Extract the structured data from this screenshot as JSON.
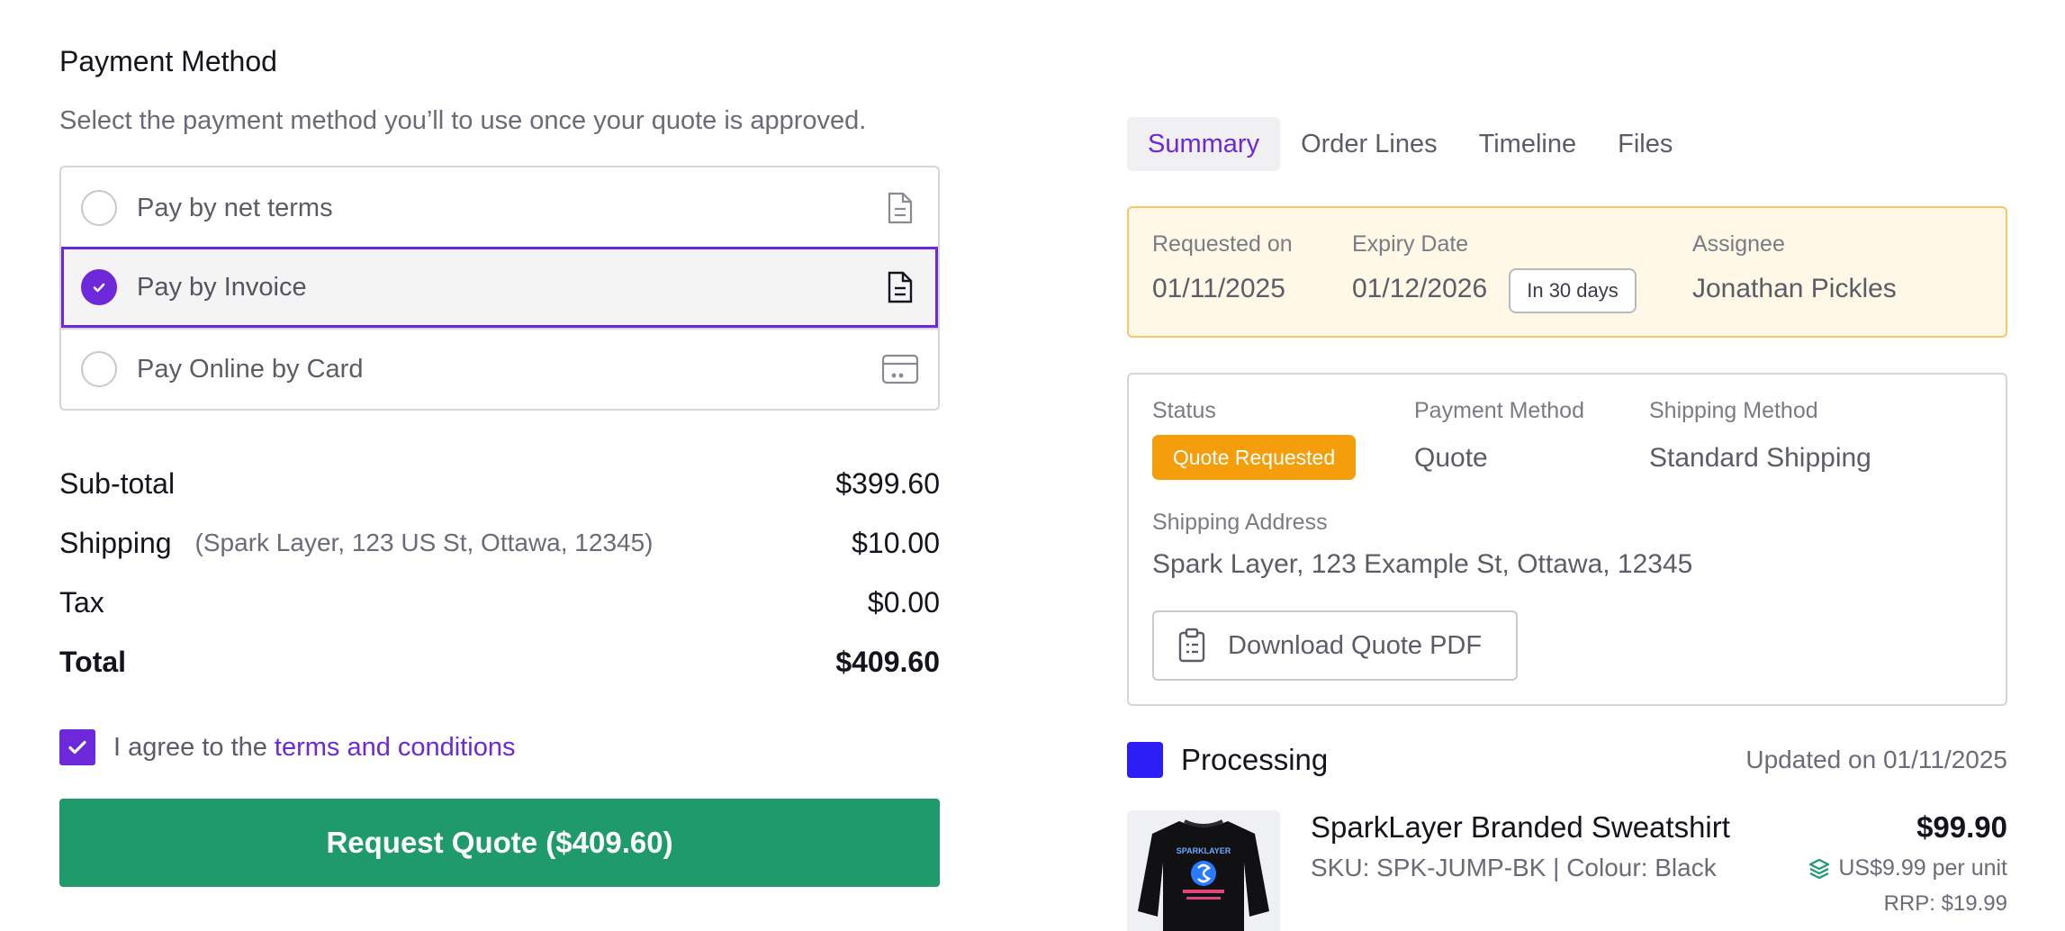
{
  "payment": {
    "title": "Payment Method",
    "subtitle": "Select the payment method you’ll to use once your quote is approved.",
    "options": [
      {
        "label": "Pay by net terms",
        "selected": false,
        "icon": "document-lines-icon"
      },
      {
        "label": "Pay by Invoice",
        "selected": true,
        "icon": "invoice-icon"
      },
      {
        "label": "Pay Online by Card",
        "selected": false,
        "icon": "credit-card-icon"
      }
    ]
  },
  "totals": {
    "subtotal_label": "Sub-total",
    "subtotal_value": "$399.60",
    "shipping_label": "Shipping",
    "shipping_note": "(Spark Layer, 123 US St, Ottawa, 12345)",
    "shipping_value": "$10.00",
    "tax_label": "Tax",
    "tax_value": "$0.00",
    "total_label": "Total",
    "total_value": "$409.60"
  },
  "agreement": {
    "checked": true,
    "text": "I agree to the",
    "link": "terms and conditions"
  },
  "request_button": "Request Quote ($409.60)",
  "tabs": [
    {
      "label": "Summary",
      "active": true
    },
    {
      "label": "Order Lines",
      "active": false
    },
    {
      "label": "Timeline",
      "active": false
    },
    {
      "label": "Files",
      "active": false
    }
  ],
  "info": {
    "requested_label": "Requested on",
    "requested_value": "01/11/2025",
    "expiry_label": "Expiry Date",
    "expiry_value": "01/12/2026",
    "expiry_badge": "In 30 days",
    "assignee_label": "Assignee",
    "assignee_value": "Jonathan Pickles"
  },
  "status": {
    "status_label": "Status",
    "status_badge": "Quote Requested",
    "payment_label": "Payment Method",
    "payment_value": "Quote",
    "shipping_label": "Shipping Method",
    "shipping_value": "Standard Shipping",
    "address_label": "Shipping Address",
    "address_value": "Spark Layer, 123 Example St, Ottawa, 12345",
    "download_label": "Download Quote PDF"
  },
  "processing": {
    "label": "Processing",
    "updated": "Updated on 01/11/2025"
  },
  "product": {
    "name": "SparkLayer Branded Sweatshirt",
    "sku": "SKU: SPK-JUMP-BK | Colour: Black",
    "price": "$99.90",
    "unit_price": "US$9.99 per unit",
    "rrp": "RRP: $19.99",
    "image_text": "SPARKLAYER"
  },
  "colors": {
    "accent": "#6d28d9",
    "primary_button": "#1e9a6c",
    "status_badge": "#f59e0b",
    "processing": "#2b1ff5",
    "info_bg": "#fff8e6",
    "info_border": "#f5c76a"
  }
}
